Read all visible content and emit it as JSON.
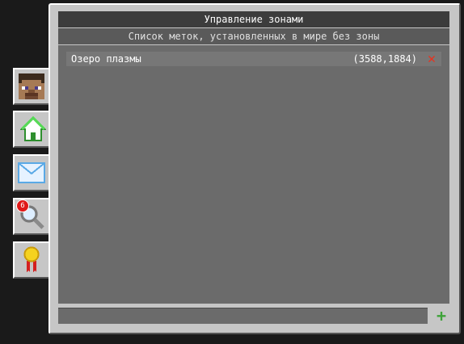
{
  "panel": {
    "title": "Управление зонами",
    "subtitle": "Список меток, установленных в мире без зоны"
  },
  "markers": [
    {
      "name": "Озеро плазмы",
      "coords": "(3588,1884)",
      "delete_icon": "close-icon"
    }
  ],
  "tabs": [
    {
      "name": "profile",
      "icon": "player-head-icon",
      "active": false
    },
    {
      "name": "home",
      "icon": "house-icon",
      "active": true
    },
    {
      "name": "mail",
      "icon": "envelope-icon",
      "active": false
    },
    {
      "name": "search",
      "icon": "magnifier-icon",
      "active": false,
      "badge": "6"
    },
    {
      "name": "awards",
      "icon": "medal-icon",
      "active": false
    }
  ],
  "input": {
    "value": ""
  },
  "add_button": {
    "icon": "plus-icon"
  },
  "colors": {
    "panel_bg": "#c6c6c6",
    "title_bg": "#3c3c3c",
    "list_bg": "#6b6b6b",
    "delete": "#e8321e",
    "add": "#3ea339",
    "badge": "#e01818"
  }
}
